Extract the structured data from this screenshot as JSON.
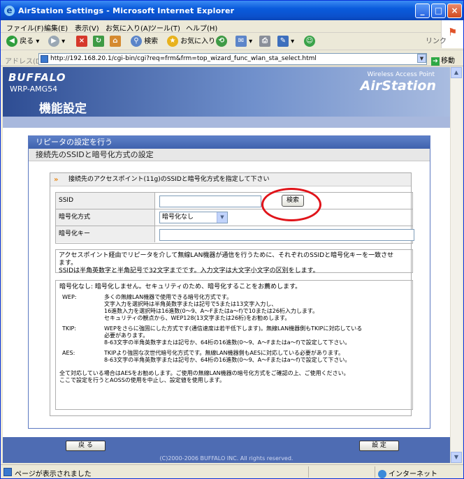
{
  "window": {
    "title": "AirStation Settings - Microsoft Internet Explorer",
    "min_label": "_",
    "max_label": "□",
    "close_label": "×"
  },
  "menu": [
    "ファイル(F)",
    "編集(E)",
    "表示(V)",
    "お気に入り(A)",
    "ツール(T)",
    "ヘルプ(H)"
  ],
  "toolbar": {
    "back_label": "戻る",
    "search_label": "検索",
    "favorites_label": "お気に入り",
    "links_label": "リンク"
  },
  "address": {
    "label": "アドレス(D)",
    "url": "http://192.168.20.1/cgi-bin/cgi?req=frm&frm=top_wizard_func_wlan_sta_select.html",
    "go_label": "移動"
  },
  "banner": {
    "brand": "BUFFALO",
    "model": "WRP-AMG54",
    "product_line": "Wireless Access Point",
    "product": "AirStation",
    "section": "機能設定"
  },
  "panel": {
    "title": "リピータの設定を行う",
    "subtitle": "接続先のSSIDと暗号化方式の設定",
    "instruction": "接続先のアクセスポイント(11g)のSSIDと暗号化方式を指定して下さい"
  },
  "form": {
    "ssid_label": "SSID",
    "ssid_value": "",
    "search_button": "検索",
    "encryption_label": "暗号化方式",
    "encryption_value": "暗号化なし",
    "key_label": "暗号化キー",
    "key_value": ""
  },
  "notes": {
    "note1_line1": "アクセスポイント経由でリピータを介して無線LAN機器が通信を行うために、それぞれのSSIDと暗号化キーを一致させ",
    "note1_line2": "ます。",
    "note1_line3": "SSIDは半角英数字と半角記号で32文字までです。入力文字は大文字小文字の区別をします。",
    "none_line": "暗号化なし: 暗号化しません。セキュリティのため、暗号化することをお薦めします。",
    "wep_key": "WEP:",
    "wep_lines": [
      "多くの無線LAN機器で使用できる暗号化方式です。",
      "文字入力を選択時は半角英数字または記号で5または13文字入力し、",
      "16進数入力を選択時は16進数(0〜9、A〜Fまたはa〜f)で10または26桁入力します。",
      "セキュリティの観点から、WEP128(13文字または26桁)をお勧めします。"
    ],
    "tkip_key": "TKIP:",
    "tkip_lines": [
      "WEPをさらに強固にした方式です(通信速度は若干低下します)。無線LAN機器側もTKIPに対応している",
      "必要があります。",
      "8-63文字の半角英数字または記号か、64桁の16進数(0〜9、A〜Fまたはa〜f)で設定して下さい。"
    ],
    "aes_key": "AES:",
    "aes_lines": [
      "TKIPより強固な次世代暗号化方式です。無線LAN機器側もAESに対応している必要があります。",
      "8-63文字の半角英数字または記号か、64桁の16進数(0〜9、A〜Fまたはa〜f)で設定して下さい。"
    ],
    "foot_line1": "全て対応している場合はAESをお勧めします。ご使用の無線LAN機器の暗号化方式をご確認の上、ご使用ください。",
    "foot_line2": "ここで設定を行うとAOSSの使用を中止し、設定値を使用します。"
  },
  "footer": {
    "back_button": "戻 る",
    "set_button": "設 定",
    "copyright": "(C)2000-2006 BUFFALO INC. All rights reserved."
  },
  "status": {
    "message": "ページが表示されました",
    "zone": "インターネット"
  }
}
